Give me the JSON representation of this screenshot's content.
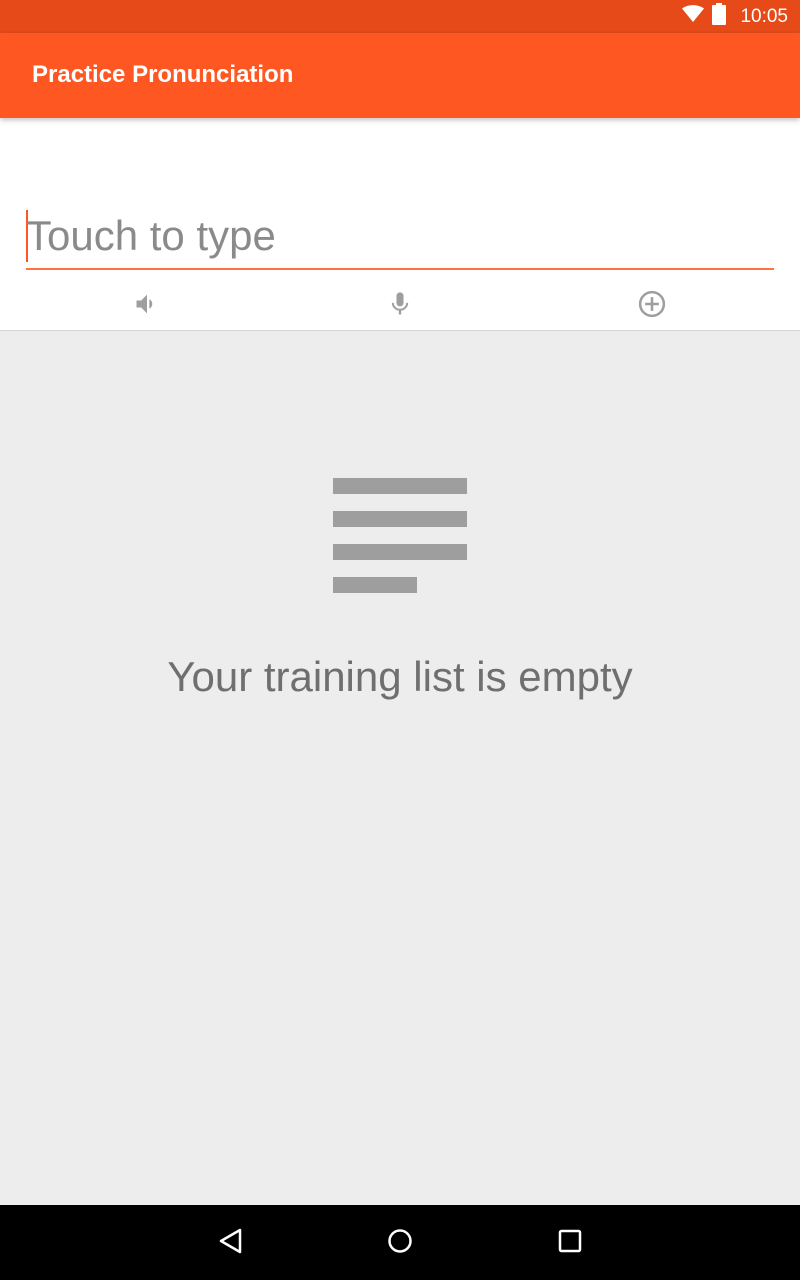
{
  "status_bar": {
    "time": "10:05",
    "icons": [
      "wifi-icon",
      "battery-icon"
    ]
  },
  "app_bar": {
    "title": "Practice Pronunciation"
  },
  "input": {
    "placeholder": "Touch to type",
    "value": ""
  },
  "actions": [
    {
      "icon": "volume-icon"
    },
    {
      "icon": "microphone-icon"
    },
    {
      "icon": "add-circle-icon"
    }
  ],
  "empty_state": {
    "icon": "list-lines-icon",
    "message": "Your training list is empty"
  },
  "navigation": {
    "buttons": [
      "back-icon",
      "home-icon",
      "recents-icon"
    ]
  },
  "colors": {
    "status_bar": "#E64A19",
    "app_bar": "#FF5722",
    "accent_underline": "#FF7043",
    "content_bg": "#EDEDED",
    "icon_gray": "#9E9E9E"
  }
}
